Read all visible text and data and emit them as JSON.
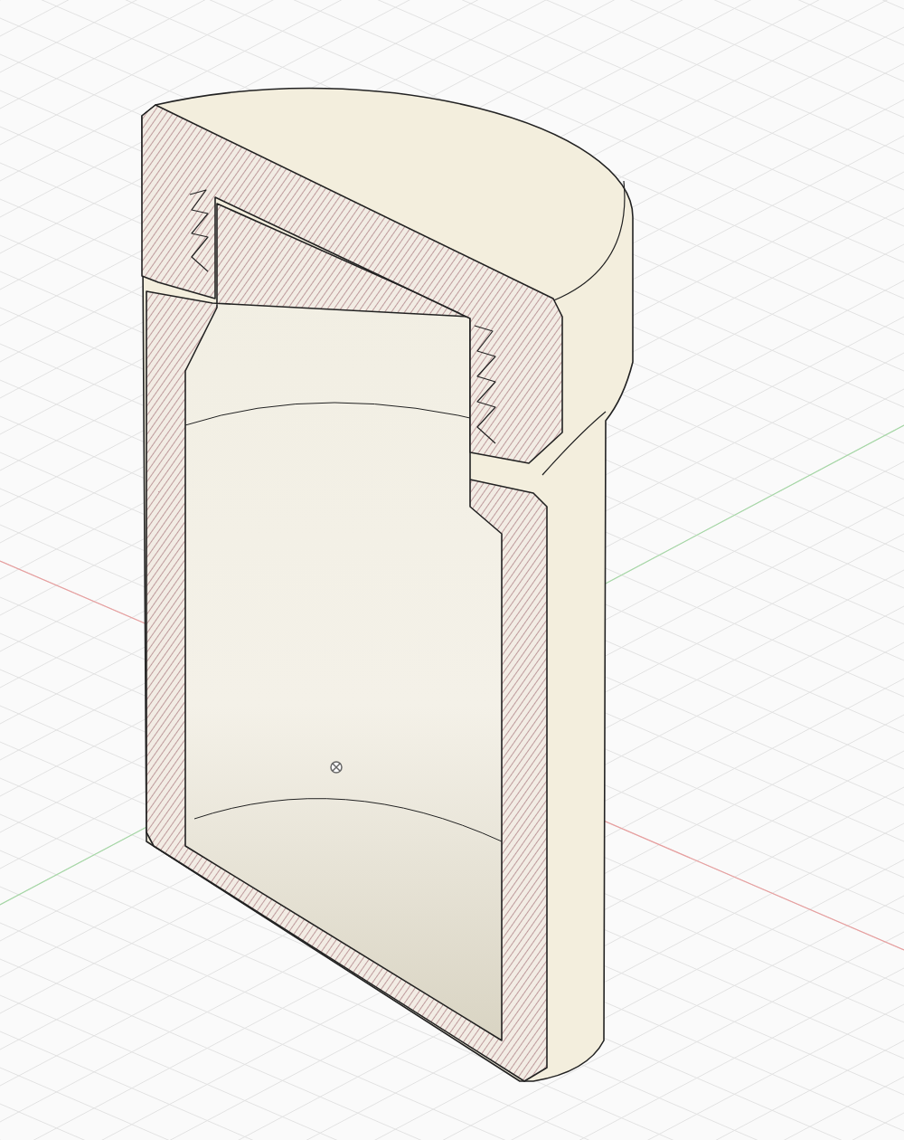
{
  "viewport": {
    "grid": true,
    "axes": true,
    "origin_marker": true
  }
}
